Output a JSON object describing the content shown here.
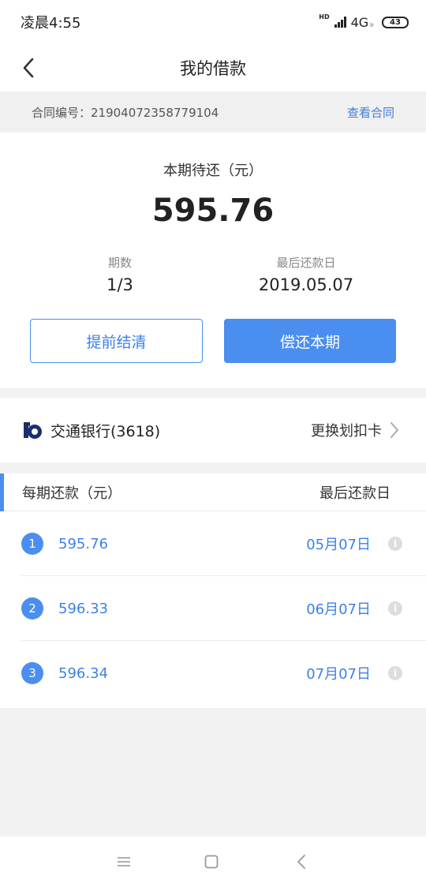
{
  "status_bar": {
    "time": "凌晨4:55",
    "hd": "HD",
    "network": "4G",
    "network_sub": "lr",
    "battery": "43"
  },
  "nav": {
    "title": "我的借款"
  },
  "contract": {
    "label": "合同编号：21904072358779104",
    "view_link": "查看合同"
  },
  "summary": {
    "due_label": "本期待还（元）",
    "due_amount": "595.76",
    "period_label": "期数",
    "period_value": "1/3",
    "last_date_label": "最后还款日",
    "last_date_value": "2019.05.07",
    "prepay_button": "提前结清",
    "repay_button": "偿还本期"
  },
  "bank": {
    "name": "交通银行(3618)",
    "change_card": "更换划扣卡"
  },
  "schedule": {
    "title": "每期还款（元）",
    "date_title": "最后还款日",
    "rows": [
      {
        "num": "1",
        "amount": "595.76",
        "date": "05月07日"
      },
      {
        "num": "2",
        "amount": "596.33",
        "date": "06月07日"
      },
      {
        "num": "3",
        "amount": "596.34",
        "date": "07月07日"
      }
    ]
  },
  "colors": {
    "accent": "#4a8ef0",
    "link": "#3e80e6",
    "background": "#f2f2f2"
  },
  "icons": [
    "back-arrow-icon",
    "bank-logo-icon",
    "chevron-right-icon",
    "info-icon",
    "menu-icon",
    "home-square-icon",
    "back-triangle-icon"
  ]
}
